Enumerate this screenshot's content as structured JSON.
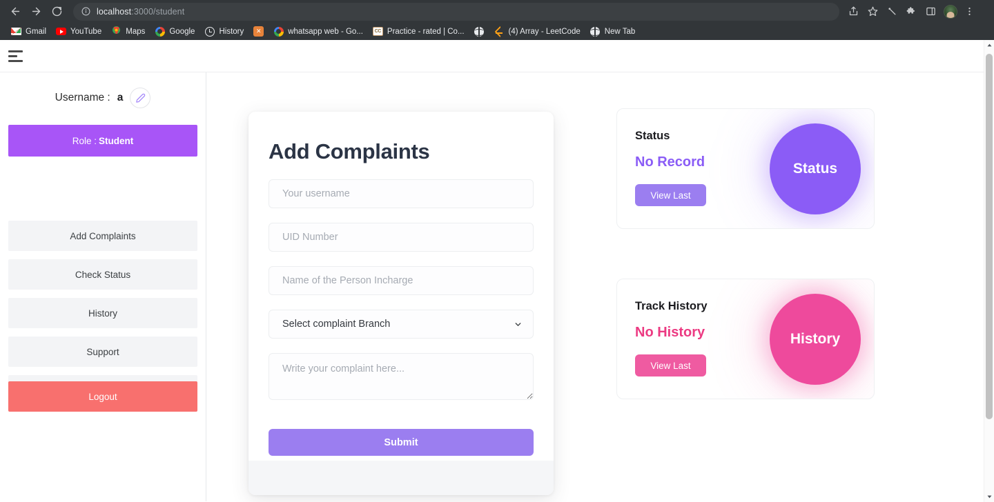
{
  "browser": {
    "url_host": "localhost",
    "url_path": ":3000/student",
    "nav": {
      "back": "back-arrow",
      "forward": "forward-arrow",
      "reload": "reload-icon"
    },
    "omnibox_icon": "info-circle-icon",
    "right_icons": [
      "share-icon",
      "bookmark-star-icon",
      "pen-icon",
      "extensions-puzzle-icon",
      "sidepanel-icon",
      "profile-avatar",
      "three-dot-menu-icon"
    ],
    "bookmarks": [
      {
        "label": "Gmail",
        "icon": "gmail-icon"
      },
      {
        "label": "YouTube",
        "icon": "youtube-icon"
      },
      {
        "label": "Maps",
        "icon": "google-maps-icon"
      },
      {
        "label": "Google",
        "icon": "google-icon"
      },
      {
        "label": "History",
        "icon": "history-clock-icon"
      },
      {
        "label": "",
        "icon": "orange-square-icon"
      },
      {
        "label": "whatsapp web - Go...",
        "icon": "google-icon"
      },
      {
        "label": "Practice - rated | Co...",
        "icon": "cc-codechef-icon"
      },
      {
        "label": "",
        "icon": "globe-icon"
      },
      {
        "label": "(4) Array - LeetCode",
        "icon": "leetcode-icon"
      },
      {
        "label": "New Tab",
        "icon": "globe-icon"
      }
    ]
  },
  "app": {
    "topbar": {
      "menu_icon": "hamburger-menu-icon"
    },
    "sidebar": {
      "username_label": "Username :",
      "username_value": "a",
      "edit_icon": "pencil-edit-icon",
      "role_label": "Role :",
      "role_value": "Student",
      "nav_items": [
        "Add Complaints",
        "Check Status",
        "History",
        "Support"
      ],
      "logout_label": "Logout"
    },
    "form": {
      "title": "Add Complaints",
      "username_placeholder": "Your username",
      "username_value": "",
      "uid_placeholder": "UID Number",
      "uid_value": "",
      "incharge_placeholder": "Name of the Person Incharge",
      "incharge_value": "",
      "branch_selected": "Select complaint Branch",
      "branch_options": [
        "Select complaint Branch"
      ],
      "branch_chevron_icon": "chevron-down-icon",
      "complaint_placeholder": "Write your complaint here...",
      "complaint_value": "",
      "submit_label": "Submit"
    },
    "cards": [
      {
        "title": "Status",
        "subtitle": "No Record",
        "button_label": "View Last",
        "blob_label": "Status",
        "color": "#8b5cf6"
      },
      {
        "title": "Track History",
        "subtitle": "No History",
        "button_label": "View Last",
        "blob_label": "History",
        "color": "#ee4a9c"
      }
    ]
  },
  "colors": {
    "role_purple": "#a855f7",
    "logout_red": "#f8706e",
    "submit_purple": "#9b7ef0",
    "status_purple": "#8b5cf6",
    "history_pink": "#ee4a9c",
    "chrome_dark": "#323639"
  }
}
